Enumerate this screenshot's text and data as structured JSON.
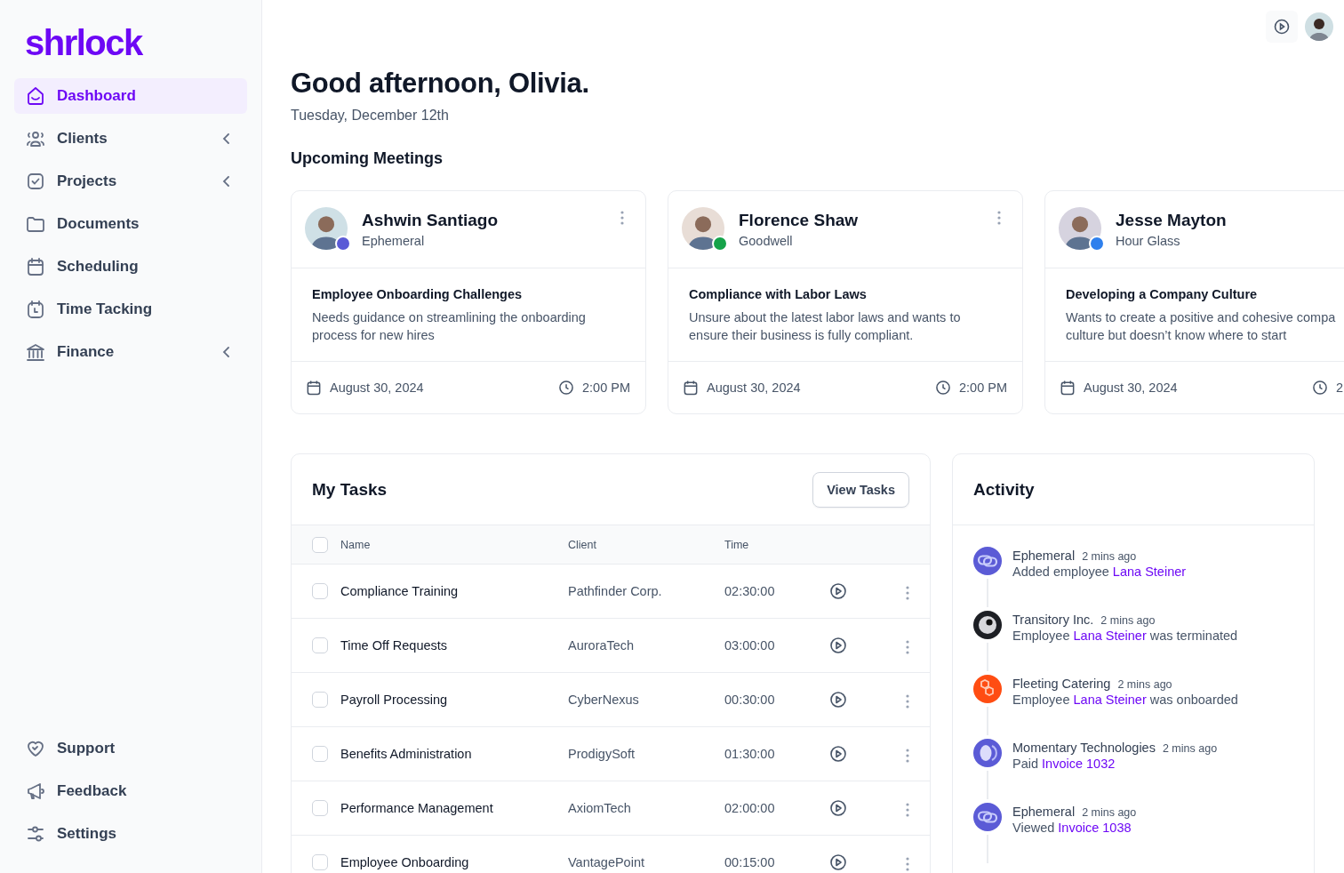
{
  "sidebar": {
    "logo": "shrlock",
    "items": [
      {
        "label": "Dashboard",
        "selected": true,
        "has_submenu": false
      },
      {
        "label": "Clients",
        "selected": false,
        "has_submenu": true
      },
      {
        "label": "Projects",
        "selected": false,
        "has_submenu": true
      },
      {
        "label": "Documents",
        "selected": false,
        "has_submenu": false
      },
      {
        "label": "Scheduling",
        "selected": false,
        "has_submenu": false
      },
      {
        "label": "Time Tacking",
        "selected": false,
        "has_submenu": false
      },
      {
        "label": "Finance",
        "selected": false,
        "has_submenu": true
      }
    ],
    "footer_items": [
      {
        "label": "Support"
      },
      {
        "label": "Feedback"
      },
      {
        "label": "Settings"
      }
    ]
  },
  "greeting": {
    "title": "Good afternoon, Olivia.",
    "date": "Tuesday, December 12th"
  },
  "meetings": {
    "title": "Upcoming Meetings",
    "cards": [
      {
        "name": "Ashwin Santiago",
        "company": "Ephemeral",
        "color": "#5b5bd6",
        "topic": "Employee Onboarding Challenges",
        "description": "Needs guidance on streamlining the onboarding process for new hires",
        "date": "August 30, 2024",
        "time": "2:00 PM"
      },
      {
        "name": "Florence Shaw",
        "company": "Goodwell",
        "color": "#16a34a",
        "topic": "Compliance with Labor Laws",
        "description": "Unsure about the latest labor laws and wants to ensure their business is fully compliant.",
        "date": "August 30, 2024",
        "time": "2:00 PM"
      },
      {
        "name": "Jesse Mayton",
        "company": "Hour Glass",
        "color": "#2f80ed",
        "topic": "Developing a Company Culture",
        "description": "Wants to create a positive and cohesive compa",
        "description_2": "culture but doesn’t know where to start",
        "date": "August 30, 2024",
        "time": "2"
      }
    ]
  },
  "tasks": {
    "title": "My Tasks",
    "button": "View Tasks",
    "all_checked": false,
    "columns": [
      "Name",
      "Client",
      "Time"
    ],
    "rows": [
      {
        "name": "Compliance Training",
        "client": "Pathfinder Corp.",
        "time": "02:30:00",
        "checked": false
      },
      {
        "name": "Time Off Requests",
        "client": "AuroraTech",
        "time": "03:00:00",
        "checked": false
      },
      {
        "name": "Payroll Processing",
        "client": "CyberNexus",
        "time": "00:30:00",
        "checked": false
      },
      {
        "name": "Benefits Administration",
        "client": "ProdigySoft",
        "time": "01:30:00",
        "checked": false
      },
      {
        "name": "Performance Management",
        "client": "AxiomTech",
        "time": "02:00:00",
        "checked": false
      },
      {
        "name": "Employee Onboarding",
        "client": "VantagePoint",
        "time": "00:15:00",
        "checked": false
      }
    ]
  },
  "activity": {
    "title": "Activity",
    "items": [
      {
        "company": "Ephemeral",
        "time": "2 mins ago",
        "kind": "chain",
        "color": "#5b5bd6",
        "before": "Added employee ",
        "link": "Lana Steiner"
      },
      {
        "company": "Transitory Inc.",
        "time": "2 mins ago",
        "kind": "eye",
        "color": "#1d1f24",
        "before": "Employee ",
        "link": "Lana Steiner",
        "after": " was terminated"
      },
      {
        "company": "Fleeting Catering",
        "time": "2 mins ago",
        "kind": "cubes",
        "color": "#ff4d12",
        "before": "Employee ",
        "link": "Lana Steiner",
        "after": " was onboarded"
      },
      {
        "company": "Momentary Technologies",
        "time": "2 mins ago",
        "kind": "moon",
        "color": "#5b5bd6",
        "before": "Paid ",
        "link": "Invoice 1032"
      },
      {
        "company": "Ephemeral",
        "time": "2 mins ago",
        "kind": "chain",
        "color": "#5b5bd6",
        "before": "Viewed ",
        "link": "Invoice 1038"
      }
    ]
  }
}
